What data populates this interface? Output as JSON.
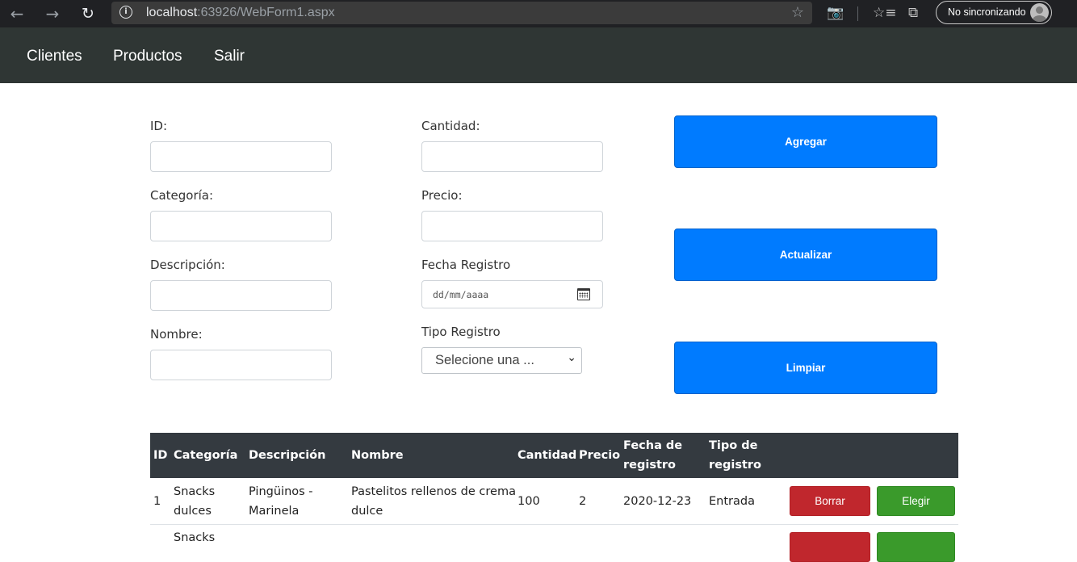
{
  "browser": {
    "url_host": "localhost",
    "url_rest": ":63926/WebForm1.aspx",
    "sync_label": "No sincronizando"
  },
  "nav": {
    "items": [
      {
        "label": "Clientes"
      },
      {
        "label": "Productos"
      },
      {
        "label": "Salir"
      }
    ]
  },
  "form": {
    "id_label": "ID:",
    "categoria_label": "Categoría:",
    "descripcion_label": "Descripción:",
    "nombre_label": "Nombre:",
    "cantidad_label": "Cantidad:",
    "precio_label": "Precio:",
    "fecha_label": "Fecha Registro",
    "fecha_placeholder": "dd/mm/aaaa",
    "tipo_label": "Tipo Registro",
    "tipo_selected": "Selecione una ...",
    "id_value": "",
    "categoria_value": "",
    "descripcion_value": "",
    "nombre_value": "",
    "cantidad_value": "",
    "precio_value": ""
  },
  "actions": {
    "agregar": "Agregar",
    "actualizar": "Actualizar",
    "limpiar": "Limpiar"
  },
  "colors": {
    "primary": "#007bff",
    "danger": "#c0272d",
    "success": "#3a9a2b",
    "navbar": "#2f3634",
    "table_header": "#343a40"
  },
  "table": {
    "headers": {
      "id": "ID",
      "categoria": "Categoría",
      "descripcion": "Descripción",
      "nombre": "Nombre",
      "cantidad": "Cantidad",
      "precio": "Precio",
      "fecha_1": "Fecha de",
      "fecha_2": "registro",
      "tipo_1": "Tipo de",
      "tipo_2": "registro"
    },
    "rows": [
      {
        "id": "1",
        "categoria_1": "Snacks",
        "categoria_2": "dulces",
        "descripcion_1": "Pingüinos -",
        "descripcion_2": "Marinela",
        "nombre_1": "Pastelitos rellenos de crema",
        "nombre_2": "dulce",
        "cantidad": "100",
        "precio": "2",
        "fecha": "2020-12-23",
        "tipo": "Entrada",
        "borrar": "Borrar",
        "elegir": "Elegir"
      },
      {
        "categoria_1": "Snacks"
      }
    ]
  }
}
